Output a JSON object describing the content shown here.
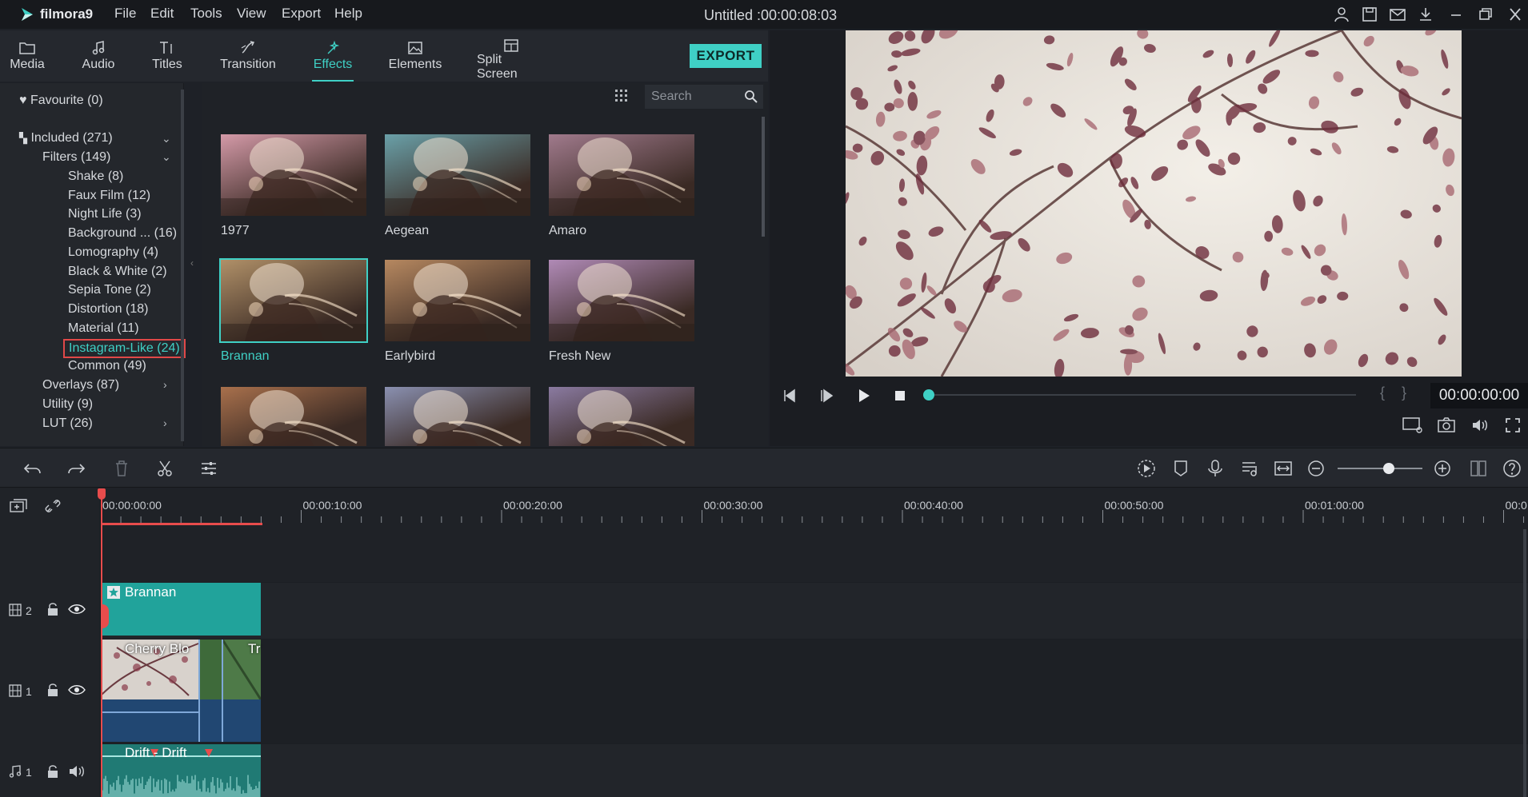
{
  "app": {
    "name": "filmora9",
    "title": "Untitled :00:00:08:03"
  },
  "menu": [
    "File",
    "Edit",
    "Tools",
    "View",
    "Export",
    "Help"
  ],
  "nav_tabs": [
    {
      "label": "Media",
      "icon": "folder-icon"
    },
    {
      "label": "Audio",
      "icon": "music-note-icon"
    },
    {
      "label": "Titles",
      "icon": "text-icon"
    },
    {
      "label": "Transition",
      "icon": "transition-icon"
    },
    {
      "label": "Effects",
      "icon": "effects-icon",
      "active": true
    },
    {
      "label": "Elements",
      "icon": "image-icon"
    },
    {
      "label": "Split Screen",
      "icon": "split-screen-icon"
    }
  ],
  "export_label": "EXPORT",
  "sidebar": {
    "favourite": "Favourite (0)",
    "included": "Included (271)",
    "filters": "Filters (149)",
    "filter_items": [
      "Shake (8)",
      "Faux Film (12)",
      "Night Life (3)",
      "Background ... (16)",
      "Lomography (4)",
      "Black & White (2)",
      "Sepia Tone (2)",
      "Distortion (18)",
      "Material (11)",
      "Instagram-Like (24)",
      "Common (49)"
    ],
    "selected_index": 9,
    "overlays": "Overlays (87)",
    "utility": "Utility (9)",
    "lut": "LUT (26)"
  },
  "search": {
    "placeholder": "Search"
  },
  "effects": [
    {
      "label": "1977",
      "tint": "#d49aa8"
    },
    {
      "label": "Aegean",
      "tint": "#6aa0a8"
    },
    {
      "label": "Amaro",
      "tint": "#a07a8c"
    },
    {
      "label": "Brannan",
      "tint": "#b09068",
      "selected": true
    },
    {
      "label": "Earlybird",
      "tint": "#b68860"
    },
    {
      "label": "Fresh New",
      "tint": "#b08ab6"
    },
    {
      "label": "",
      "tint": "#a8704c"
    },
    {
      "label": "",
      "tint": "#8a90b0"
    },
    {
      "label": "",
      "tint": "#8a7aa0"
    }
  ],
  "preview": {
    "timecode": "00:00:00:00",
    "braces": "{ }"
  },
  "ruler": [
    "00:00:00:00",
    "00:00:10:00",
    "00:00:20:00",
    "00:00:30:00",
    "00:00:40:00",
    "00:00:50:00",
    "00:01:00:00",
    "00:0"
  ],
  "tracks": {
    "effect_track_num": "2",
    "video_track_num": "1",
    "audio_track_num": "1",
    "effect_clip": "Brannan",
    "video_clip_1": "Cherry Blo",
    "video_clip_2": "Tr",
    "audio_clip": "Drift - Drift"
  },
  "colors": {
    "accent": "#3fd0c5",
    "playhead": "#e84c4c",
    "effect_clip": "#21a39b",
    "video_clip": "#214772",
    "audio_clip": "#207a74"
  }
}
